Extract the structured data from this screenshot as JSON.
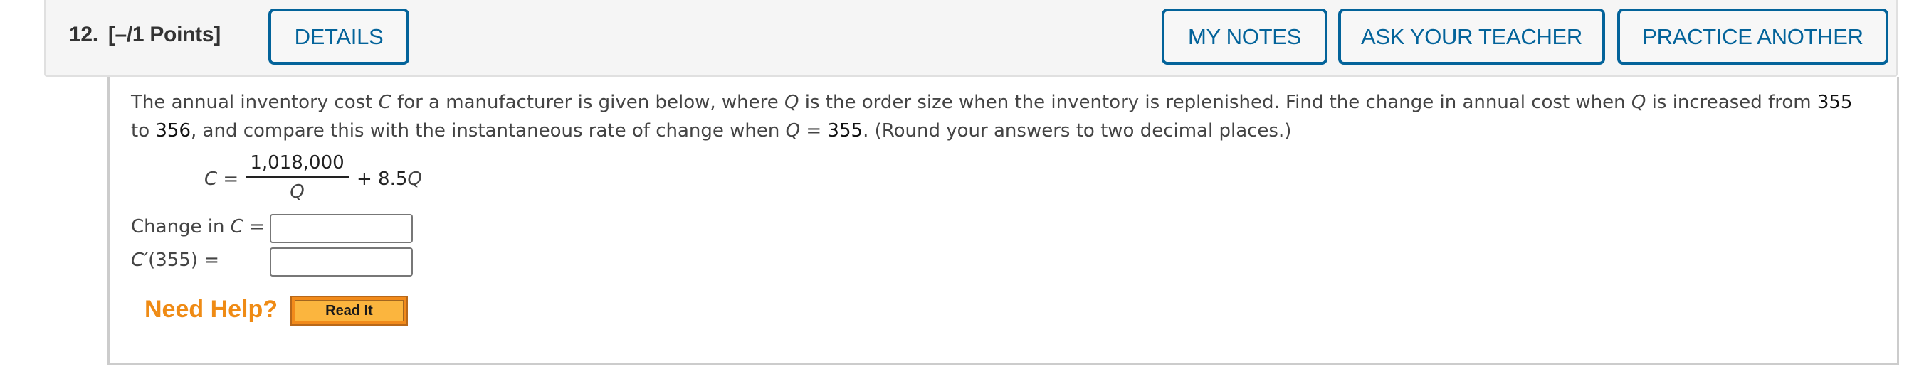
{
  "question": {
    "number": "12.",
    "points": "[–/1 Points]"
  },
  "header_buttons": {
    "details": "DETAILS",
    "my_notes": "MY NOTES",
    "ask_teacher": "ASK YOUR TEACHER",
    "practice_another": "PRACTICE ANOTHER"
  },
  "prompt": {
    "p1": "The annual inventory cost ",
    "var_c": "C",
    "p2": " for a manufacturer is given below, where ",
    "var_q": "Q",
    "p3": " is the order size when the inventory is replenished. Find the change in annual cost when ",
    "p4": " is increased from ",
    "from_value": "355",
    "p5": " to ",
    "to_value": "356",
    "p6": ", and compare this with the instantaneous rate of change when ",
    "p7": " = ",
    "at_value": "355",
    "p8": ". (Round your answers to two decimal places.)"
  },
  "formula": {
    "lhs_var": "C",
    "equals": " = ",
    "numerator": "1,018,000",
    "denominator": "Q",
    "plus_term": "+ 8.5",
    "plus_var": "Q"
  },
  "answers": [
    {
      "label_prefix": "Change in ",
      "label_var": "C",
      "label_suffix": " =",
      "value": ""
    },
    {
      "label_var": "C′",
      "label_suffix": "(355) =",
      "value": ""
    }
  ],
  "help": {
    "need_help": "Need Help?",
    "read_it": "Read It"
  },
  "colors": {
    "accent_blue": "#03639a",
    "help_orange": "#ef8b15",
    "read_it_fill": "#fbb53e"
  }
}
